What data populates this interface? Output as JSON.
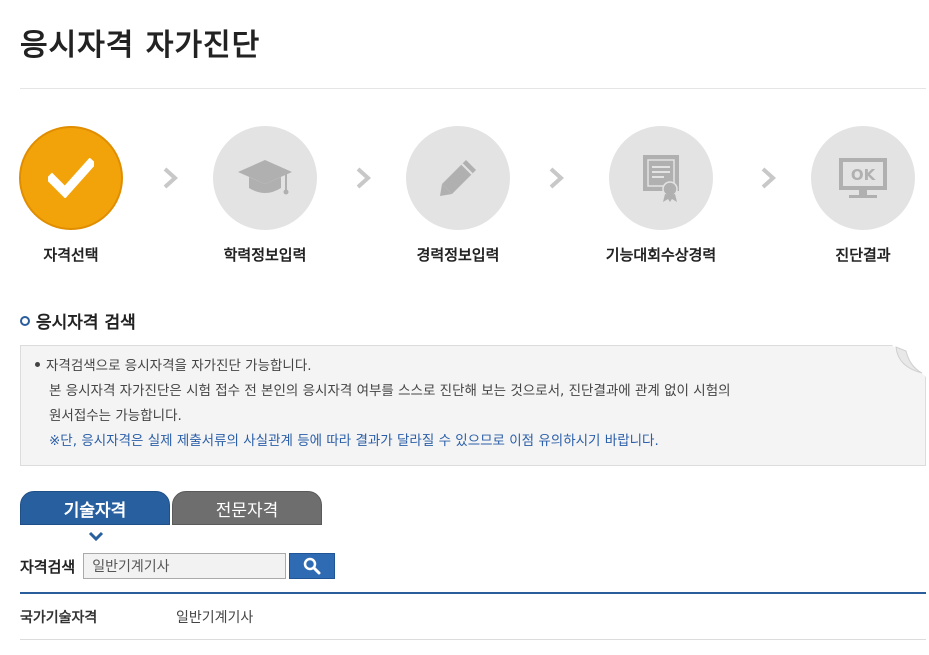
{
  "page": {
    "title": "응시자격 자가진단"
  },
  "steps": [
    {
      "label": "자격선택",
      "icon": "check-icon",
      "active": true
    },
    {
      "label": "학력정보입력",
      "icon": "graduation-cap-icon",
      "active": false
    },
    {
      "label": "경력정보입력",
      "icon": "pencil-icon",
      "active": false
    },
    {
      "label": "기능대회수상경력",
      "icon": "certificate-icon",
      "active": false
    },
    {
      "label": "진단결과",
      "icon": "ok-monitor-icon",
      "active": false
    }
  ],
  "section": {
    "title": "응시자격 검색"
  },
  "notice": {
    "line1": "자격검색으로 응시자격을 자가진단 가능합니다.",
    "line2": "본 응시자격 자가진단은 시험 접수 전 본인의 응시자격 여부를 스스로 진단해 보는 것으로서, 진단결과에 관계 없이 시험의",
    "line3": "원서접수는 가능합니다.",
    "line4": "※단, 응시자격은 실제 제출서류의 사실관계 등에 따라 결과가 달라질 수 있으므로 이점 유의하시기 바랍니다."
  },
  "tabs": [
    {
      "label": "기술자격",
      "active": true
    },
    {
      "label": "전문자격",
      "active": false
    }
  ],
  "search": {
    "label": "자격검색",
    "value": "일반기계기사"
  },
  "result": {
    "category": "국가기술자격",
    "value": "일반기계기사"
  },
  "colors": {
    "accent": "#f3a30a",
    "primary": "#275f9f",
    "inactive_tab": "#6e6e6e",
    "step_inactive": "#e3e3e3"
  }
}
